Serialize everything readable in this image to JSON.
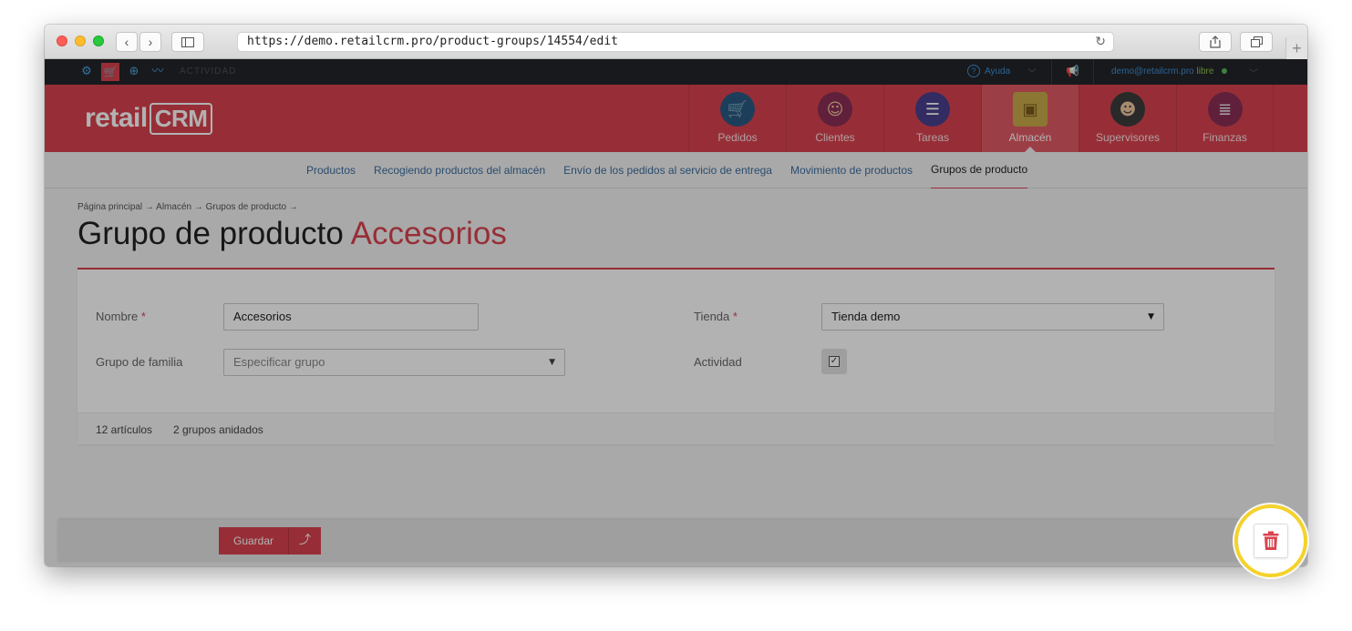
{
  "browser": {
    "url": "https://demo.retailcrm.pro/product-groups/14554/edit"
  },
  "topbar": {
    "activity_label": "ACTIVIDAD",
    "help_label": "Ayuda",
    "user_email": "demo@retailcrm.pro",
    "user_status": "libre"
  },
  "header": {
    "logo_text": "retail",
    "logo_crm": "CRM",
    "nav": [
      {
        "label": "Pedidos",
        "icon": "cart-icon",
        "color": "#2a5a82"
      },
      {
        "label": "Clientes",
        "icon": "customer-icon",
        "color": "#8a2e57"
      },
      {
        "label": "Tareas",
        "icon": "tasks-icon",
        "color": "#4a3f8f"
      },
      {
        "label": "Almacén",
        "icon": "box-icon",
        "color": "#c9a94a"
      },
      {
        "label": "Supervisores",
        "icon": "supervisor-icon",
        "color": "#3c3c3c"
      },
      {
        "label": "Finanzas",
        "icon": "finance-icon",
        "color": "#8a2e57"
      }
    ]
  },
  "subnav": [
    "Productos",
    "Recogiendo productos del almacén",
    "Envío de los pedidos al servicio de entrega",
    "Movimiento de productos",
    "Grupos de producto"
  ],
  "breadcrumb": "Página principal → Almacén → Grupos de producto →",
  "page": {
    "title_prefix": "Grupo de producto",
    "title_name": "Accesorios"
  },
  "form": {
    "name_label": "Nombre",
    "name_value": "Accesorios",
    "family_label": "Grupo de familia",
    "family_placeholder": "Especificar grupo",
    "store_label": "Tienda",
    "store_value": "Tienda demo",
    "activity_label": "Actividad",
    "activity_checked": true,
    "required_mark": "*"
  },
  "footer": {
    "articles": "12 artículos",
    "nested": "2 grupos anidados"
  },
  "actions": {
    "save_label": "Guardar",
    "save_arrow": "⤴"
  },
  "colors": {
    "brand_red": "#d9434f",
    "highlight_ring": "#f5d22a"
  }
}
